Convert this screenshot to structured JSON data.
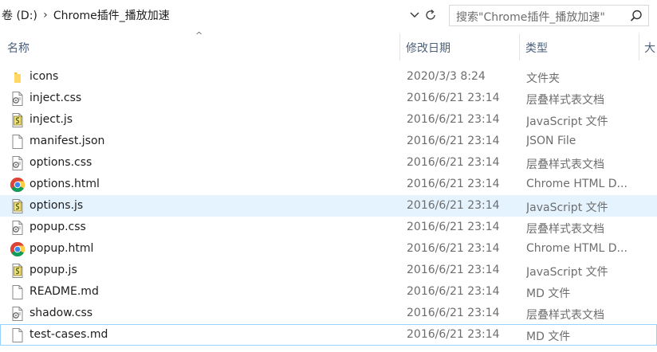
{
  "address": {
    "crumbs": [
      "卷 (D:)",
      "Chrome插件_播放加速"
    ]
  },
  "search": {
    "placeholder": "搜索\"Chrome插件_播放加速\""
  },
  "columns": {
    "name": "名称",
    "date": "修改日期",
    "type": "类型",
    "size": "大"
  },
  "files": [
    {
      "name": "icons",
      "date": "2020/3/3 8:24",
      "type": "文件夹",
      "icon": "folder-icon"
    },
    {
      "name": "inject.css",
      "date": "2016/6/21 23:14",
      "type": "层叠样式表文档",
      "icon": "css-file-icon"
    },
    {
      "name": "inject.js",
      "date": "2016/6/21 23:14",
      "type": "JavaScript 文件",
      "icon": "js-file-icon"
    },
    {
      "name": "manifest.json",
      "date": "2016/6/21 23:14",
      "type": "JSON File",
      "icon": "blank-file-icon"
    },
    {
      "name": "options.css",
      "date": "2016/6/21 23:14",
      "type": "层叠样式表文档",
      "icon": "css-file-icon"
    },
    {
      "name": "options.html",
      "date": "2016/6/21 23:14",
      "type": "Chrome HTML D...",
      "icon": "chrome-icon"
    },
    {
      "name": "options.js",
      "date": "2016/6/21 23:14",
      "type": "JavaScript 文件",
      "icon": "js-file-icon"
    },
    {
      "name": "popup.css",
      "date": "2016/6/21 23:14",
      "type": "层叠样式表文档",
      "icon": "css-file-icon"
    },
    {
      "name": "popup.html",
      "date": "2016/6/21 23:14",
      "type": "Chrome HTML D...",
      "icon": "chrome-icon"
    },
    {
      "name": "popup.js",
      "date": "2016/6/21 23:14",
      "type": "JavaScript 文件",
      "icon": "js-file-icon"
    },
    {
      "name": "README.md",
      "date": "2016/6/21 23:14",
      "type": "MD 文件",
      "icon": "blank-file-icon"
    },
    {
      "name": "shadow.css",
      "date": "2016/6/21 23:14",
      "type": "层叠样式表文档",
      "icon": "css-file-icon"
    },
    {
      "name": "test-cases.md",
      "date": "2016/6/21 23:14",
      "type": "MD 文件",
      "icon": "blank-file-icon"
    }
  ],
  "state": {
    "hovered_file": "options.js",
    "focused_file": "test-cases.md"
  },
  "colors": {
    "hover": "#e5f3ff",
    "focus_border": "#99d1ff",
    "header_text": "#4c607a"
  }
}
